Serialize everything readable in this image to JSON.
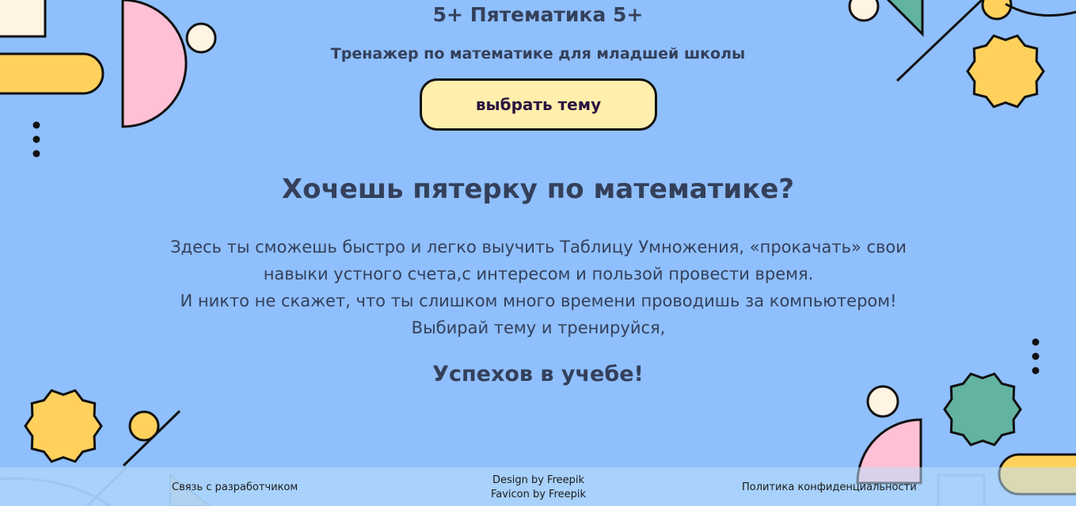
{
  "header": {
    "title": "5+ Пятематика 5+",
    "subtitle": "Тренажер по математике для младшей школы",
    "topic_button": "выбрать тему"
  },
  "main": {
    "headline": "Хочешь пятерку по математике?",
    "description_lines": [
      "Здесь ты сможешь быстро и легко выучить Таблицу Умножения, «прокачать» свои",
      "навыки устного счета,с интересом и пользой провести время.",
      "И никто не скажет, что ты слишком много времени проводишь за компьютером!",
      "Выбирай тему и тренируйся,"
    ],
    "wish": "Успехов в учебе!"
  },
  "footer": {
    "contact": "Связь с разработчиком",
    "design_credit": "Design by Freepik",
    "favicon_credit": "Favicon by Freepik",
    "privacy": "Политика конфиденциальности"
  },
  "colors": {
    "background": "#8fbffd",
    "button_bg": "#ffeeac",
    "yellow": "#ffd15c",
    "pink": "#ffbfd4",
    "teal": "#62b3a2",
    "cream": "#fff3e2",
    "text": "#34405a"
  }
}
